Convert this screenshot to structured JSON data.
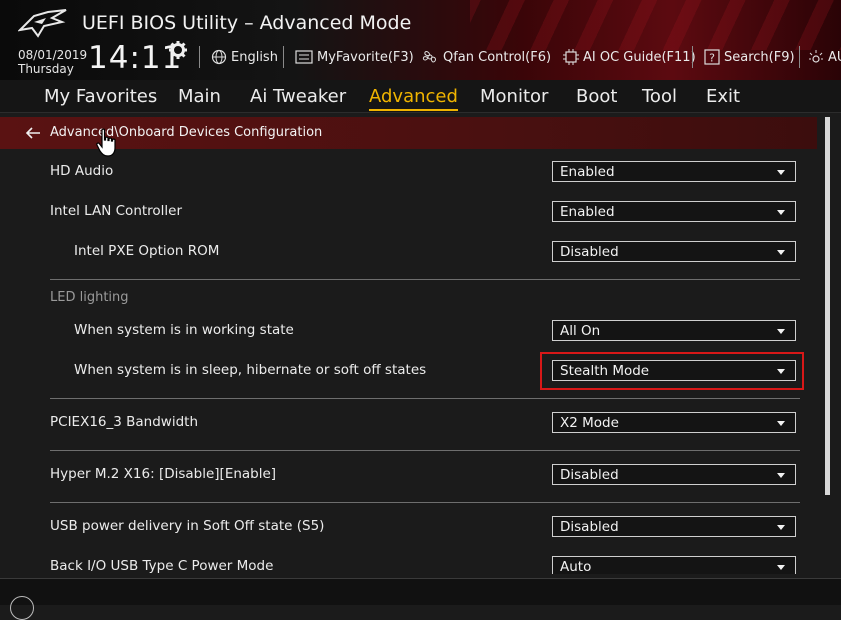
{
  "header": {
    "title": "UEFI BIOS Utility – Advanced Mode",
    "date": "08/01/2019",
    "day": "Thursday",
    "time": "14:11",
    "tools": [
      {
        "label": "English",
        "icon": "globe-icon"
      },
      {
        "label": "MyFavorite(F3)",
        "icon": "favorite-list-icon"
      },
      {
        "label": "Qfan Control(F6)",
        "icon": "fan-icon"
      },
      {
        "label": "AI OC Guide(F11)",
        "icon": "ai-chip-icon"
      },
      {
        "label": "Search(F9)",
        "icon": "search-help-icon"
      },
      {
        "label": "AU",
        "icon": "aura-icon"
      }
    ]
  },
  "menu": {
    "items": [
      "My Favorites",
      "Main",
      "Ai Tweaker",
      "Advanced",
      "Monitor",
      "Boot",
      "Tool",
      "Exit"
    ],
    "active": "Advanced"
  },
  "breadcrumb": "Advanced\\Onboard Devices Configuration",
  "settings": [
    {
      "label": "HD Audio",
      "value": "Enabled"
    },
    {
      "label": "Intel LAN Controller",
      "value": "Enabled"
    },
    {
      "label": "Intel PXE Option ROM",
      "value": "Disabled"
    },
    {
      "label": "LED lighting"
    },
    {
      "label": "When system is in working state",
      "value": "All On"
    },
    {
      "label": "When system is in sleep, hibernate or soft off states",
      "value": "Stealth Mode"
    },
    {
      "label": "PCIEX16_3 Bandwidth",
      "value": "X2 Mode"
    },
    {
      "label": "Hyper M.2 X16: [Disable][Enable]",
      "value": "Disabled"
    },
    {
      "label": "USB power delivery in Soft Off state (S5)",
      "value": "Disabled"
    },
    {
      "label": "Back I/O USB Type C Power Mode",
      "value": "Auto"
    }
  ],
  "colors": {
    "accent": "#f0b400",
    "highlight": "#d81818",
    "breadcrumb_bg": "#5a1212"
  }
}
